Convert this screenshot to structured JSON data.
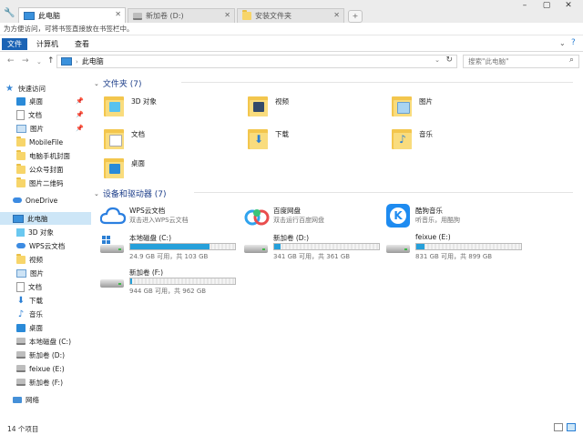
{
  "browser": {
    "tabs": [
      {
        "label": "此电脑",
        "active": true
      },
      {
        "label": "新加卷 (D:)",
        "active": false
      },
      {
        "label": "安装文件夹",
        "active": false
      }
    ],
    "bookmark_hint": "为方便访问，可将书签直接放在书签栏中。"
  },
  "ribbon": {
    "file": "文件",
    "computer": "计算机",
    "view": "查看"
  },
  "address": {
    "path": "此电脑",
    "search_placeholder": "搜索\"此电脑\""
  },
  "sidebar": {
    "quick_access": "快速访问",
    "items": [
      {
        "label": "桌面",
        "icon": "desktop-icon"
      },
      {
        "label": "文档",
        "icon": "document-icon"
      },
      {
        "label": "图片",
        "icon": "pictures-icon"
      },
      {
        "label": "MobileFile",
        "icon": "folder-icon"
      },
      {
        "label": "电脑手机封面",
        "icon": "folder-icon"
      },
      {
        "label": "公众号封面",
        "icon": "folder-icon"
      },
      {
        "label": "图片二维码",
        "icon": "folder-icon"
      }
    ],
    "onedrive": "OneDrive",
    "this_pc": "此电脑",
    "pc_items": [
      {
        "label": "3D 对象"
      },
      {
        "label": "WPS云文档"
      },
      {
        "label": "视频"
      },
      {
        "label": "图片"
      },
      {
        "label": "文档"
      },
      {
        "label": "下载"
      },
      {
        "label": "音乐"
      },
      {
        "label": "桌面"
      },
      {
        "label": "本地磁盘 (C:)"
      },
      {
        "label": "新加卷 (D:)"
      },
      {
        "label": "feixue (E:)"
      },
      {
        "label": "新加卷 (F:)"
      }
    ],
    "network": "网络"
  },
  "main": {
    "folders_header": "文件夹 (7)",
    "folders": [
      {
        "label": "3D 对象"
      },
      {
        "label": "视频"
      },
      {
        "label": "图片"
      },
      {
        "label": "文档"
      },
      {
        "label": "下载"
      },
      {
        "label": "音乐"
      },
      {
        "label": "桌面"
      }
    ],
    "devices_header": "设备和驱动器 (7)",
    "apps": [
      {
        "name": "WPS云文档",
        "desc": "双击进入WPS云文档"
      },
      {
        "name": "百度网盘",
        "desc": "双击运行百度网盘"
      },
      {
        "name": "酷狗音乐",
        "desc": "听音乐，用酷狗"
      }
    ],
    "drives": [
      {
        "name": "本地磁盘 (C:)",
        "size": "24.9 GB 可用，共 103 GB",
        "used_fraction": 0.76
      },
      {
        "name": "新加卷 (D:)",
        "size": "341 GB 可用，共 361 GB",
        "used_fraction": 0.06
      },
      {
        "name": "feixue (E:)",
        "size": "831 GB 可用，共 899 GB",
        "used_fraction": 0.08
      },
      {
        "name": "新加卷 (F:)",
        "size": "944 GB 可用，共 962 GB",
        "used_fraction": 0.02
      }
    ]
  },
  "status": {
    "count": "14 个项目"
  }
}
